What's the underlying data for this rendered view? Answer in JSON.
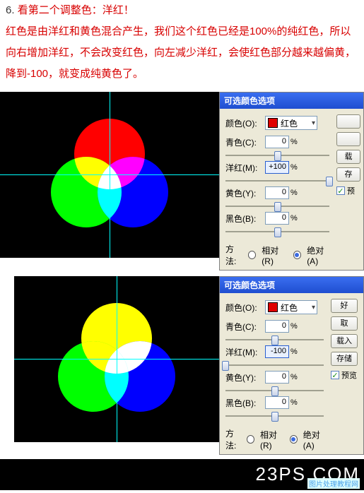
{
  "article": {
    "line1_num": "6.",
    "line1_text": "看第二个调整色：洋红！",
    "line2": "红色是由洋红和黄色混合产生，我们这个红色已经是100%的纯红色，所以向右增加洋红，不会改变红色，向左减少洋红，会使红色部分越来越偏黄，降到-100，就变成纯黄色了。"
  },
  "dialog1": {
    "title": "可选颜色选项",
    "color_label": "颜色(O):",
    "color_name": "红色",
    "sliders": {
      "cyan": {
        "label": "青色(C):",
        "value": "0",
        "pos": 50
      },
      "magenta": {
        "label": "洋红(M):",
        "value": "+100",
        "pos": 100
      },
      "yellow": {
        "label": "黄色(Y):",
        "value": "0",
        "pos": 50
      },
      "black": {
        "label": "黑色(B):",
        "value": "0",
        "pos": 50
      }
    },
    "method_label": "方法:",
    "method_rel": "相对(R)",
    "method_abs": "绝对(A)",
    "pct": "%",
    "buttons": {
      "b1": "",
      "b2": "",
      "b3": "载",
      "b4": "存",
      "preview": "预"
    }
  },
  "dialog2": {
    "title": "可选颜色选项",
    "color_label": "颜色(O):",
    "color_name": "红色",
    "sliders": {
      "cyan": {
        "label": "青色(C):",
        "value": "0",
        "pos": 50
      },
      "magenta": {
        "label": "洋红(M):",
        "value": "-100",
        "pos": 0
      },
      "yellow": {
        "label": "黄色(Y):",
        "value": "0",
        "pos": 50
      },
      "black": {
        "label": "黑色(B):",
        "value": "0",
        "pos": 50
      }
    },
    "method_label": "方法:",
    "method_rel": "相对(R)",
    "method_abs": "绝对(A)",
    "pct": "%",
    "buttons": {
      "b1": "好",
      "b2": "取",
      "b3": "载入",
      "b4": "存储",
      "preview": "预览"
    }
  },
  "footer": {
    "logo": "23PS.COM",
    "sub": "图片处理教程网"
  },
  "venn1": {
    "top_color": "#ff0000",
    "left_color": "#00ff00",
    "right_color": "#0000ff",
    "tl_mix": "#ffff00",
    "tr_mix": "#ff00ff",
    "lr_mix": "#00ffff",
    "center": "#ffffff"
  },
  "venn2": {
    "top_color": "#ffff00",
    "left_color": "#00ff00",
    "right_color": "#0000ff",
    "tl_mix": "#ffff00",
    "tr_mix": "#ffffff",
    "lr_mix": "#00ffff",
    "center": "#ffffff"
  }
}
